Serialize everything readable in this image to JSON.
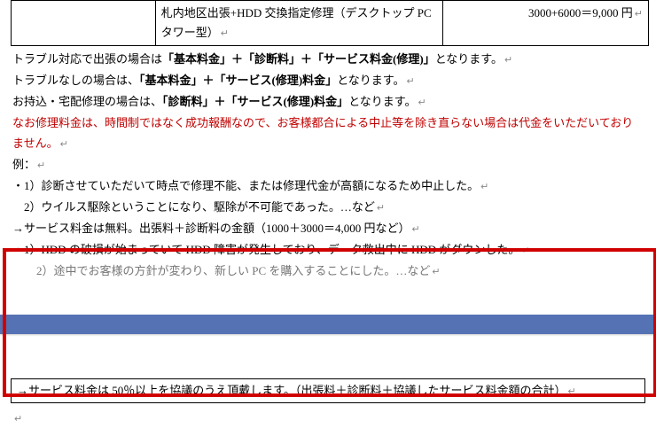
{
  "table": {
    "row": {
      "c1": "",
      "c2": "札内地区出張+HDD 交換指定修理（デスクトップ PC タワー型）",
      "c3": "3000+6000＝9,000 円"
    }
  },
  "p1a": "トラブル対応で出張の場合は",
  "p1b": "「基本料金」＋「診断料」＋「サービス料金(修理)」",
  "p1c": "となります。",
  "p2a": "トラブルなしの場合は、",
  "p2b": "「基本料金」＋「サービス(修理)料金」",
  "p2c": "となります。",
  "p3a": "お持込・宅配修理の場合は、",
  "p3b": "「診断料」＋「サービス(修理)料金」",
  "p3c": "となります。",
  "p4": "なお修理料金は、時間制ではなく成功報酬なので、お客様都合による中止等を除き直らない場合は代金をいただいておりません。",
  "p5": "例：",
  "p6": "・1）診断させていただいて時点で修理不能、または修理代金が高額になるため中止した。",
  "p7": "　2）ウイルス駆除ということになり、駆除が不可能であった。…など",
  "p8": "→サービス料金は無料。出張料＋診断料の金額（1000＋3000＝4,000 円など）",
  "p9": "・1）HDD の破損が始まっていて HDD 障害が発生しており、データ救出中に HDD がダウンした。",
  "p10": "　2）途中でお客様の方針が変わり、新しい PC を購入することにした。…など",
  "footer": "→サービス料金は 50％以上を協議のうえ頂戴します。（出張料＋診断料＋協議したサービス料金額の合計）",
  "ret": "↵"
}
